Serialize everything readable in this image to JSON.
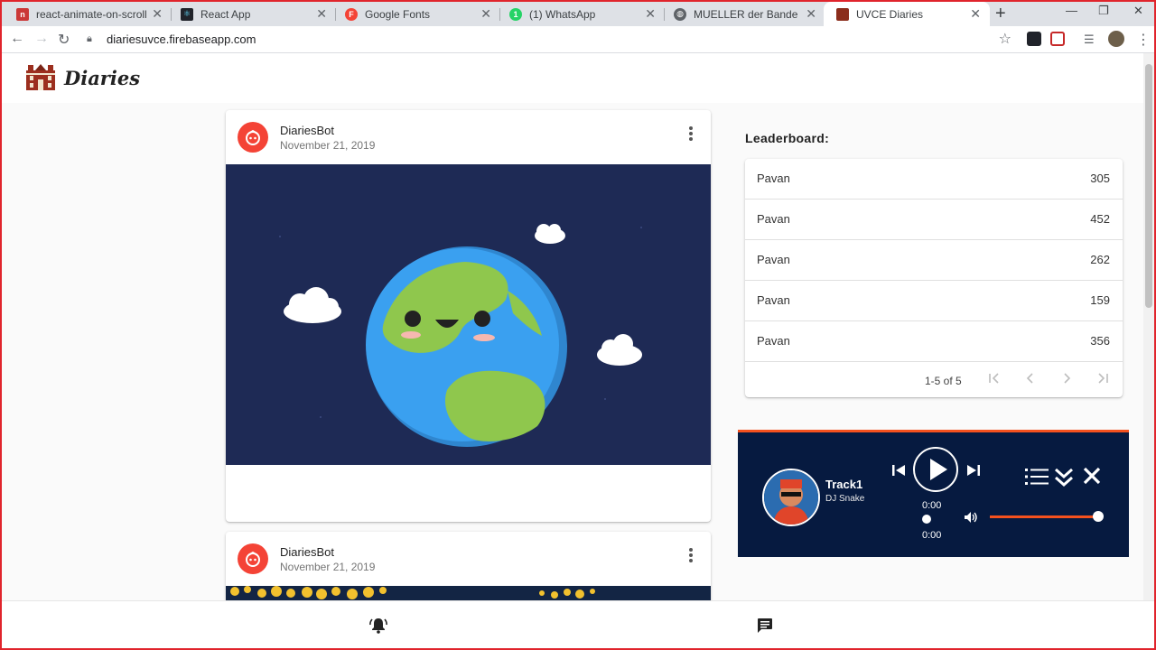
{
  "browser": {
    "tabs": [
      {
        "title": "react-animate-on-scroll - npm",
        "favicon": "npm-icon",
        "color": "#cb3837",
        "active": false
      },
      {
        "title": "React App",
        "favicon": "react-icon",
        "color": "#20232a",
        "active": false
      },
      {
        "title": "Google Fonts",
        "favicon": "google-fonts-icon",
        "color": "#f44336",
        "active": false
      },
      {
        "title": "(1) WhatsApp",
        "favicon": "whatsapp-icon",
        "color": "#25d366",
        "active": false
      },
      {
        "title": "MUELLER der Bande Vier",
        "favicon": "globe-icon",
        "color": "#5f6368",
        "active": false
      },
      {
        "title": "UVCE Diaries",
        "favicon": "diaries-icon",
        "color": "#8b2d1c",
        "active": true
      }
    ],
    "url": "diariesuvce.firebaseapp.com"
  },
  "app": {
    "brand": "Diaries"
  },
  "posts": [
    {
      "author": "DiariesBot",
      "date": "November 21, 2019",
      "image": "earth-illustration"
    },
    {
      "author": "DiariesBot",
      "date": "November 21, 2019",
      "image": "pattern-illustration"
    }
  ],
  "leaderboard": {
    "title": "Leaderboard:",
    "rows": [
      {
        "name": "Pavan",
        "score": "305"
      },
      {
        "name": "Pavan",
        "score": "452"
      },
      {
        "name": "Pavan",
        "score": "262"
      },
      {
        "name": "Pavan",
        "score": "159"
      },
      {
        "name": "Pavan",
        "score": "356"
      }
    ],
    "range": "1-5 of 5"
  },
  "player": {
    "track": "Track1",
    "artist": "DJ Snake",
    "current_time": "0:00",
    "duration": "0:00",
    "volume": 0.9,
    "accent": "#f4511e",
    "background": "#061a40"
  },
  "bottom_nav": [
    "notifications-active-icon",
    "chat-icon"
  ],
  "colors": {
    "avatar": "#f44336",
    "earth_bg": "#1e2a55"
  }
}
